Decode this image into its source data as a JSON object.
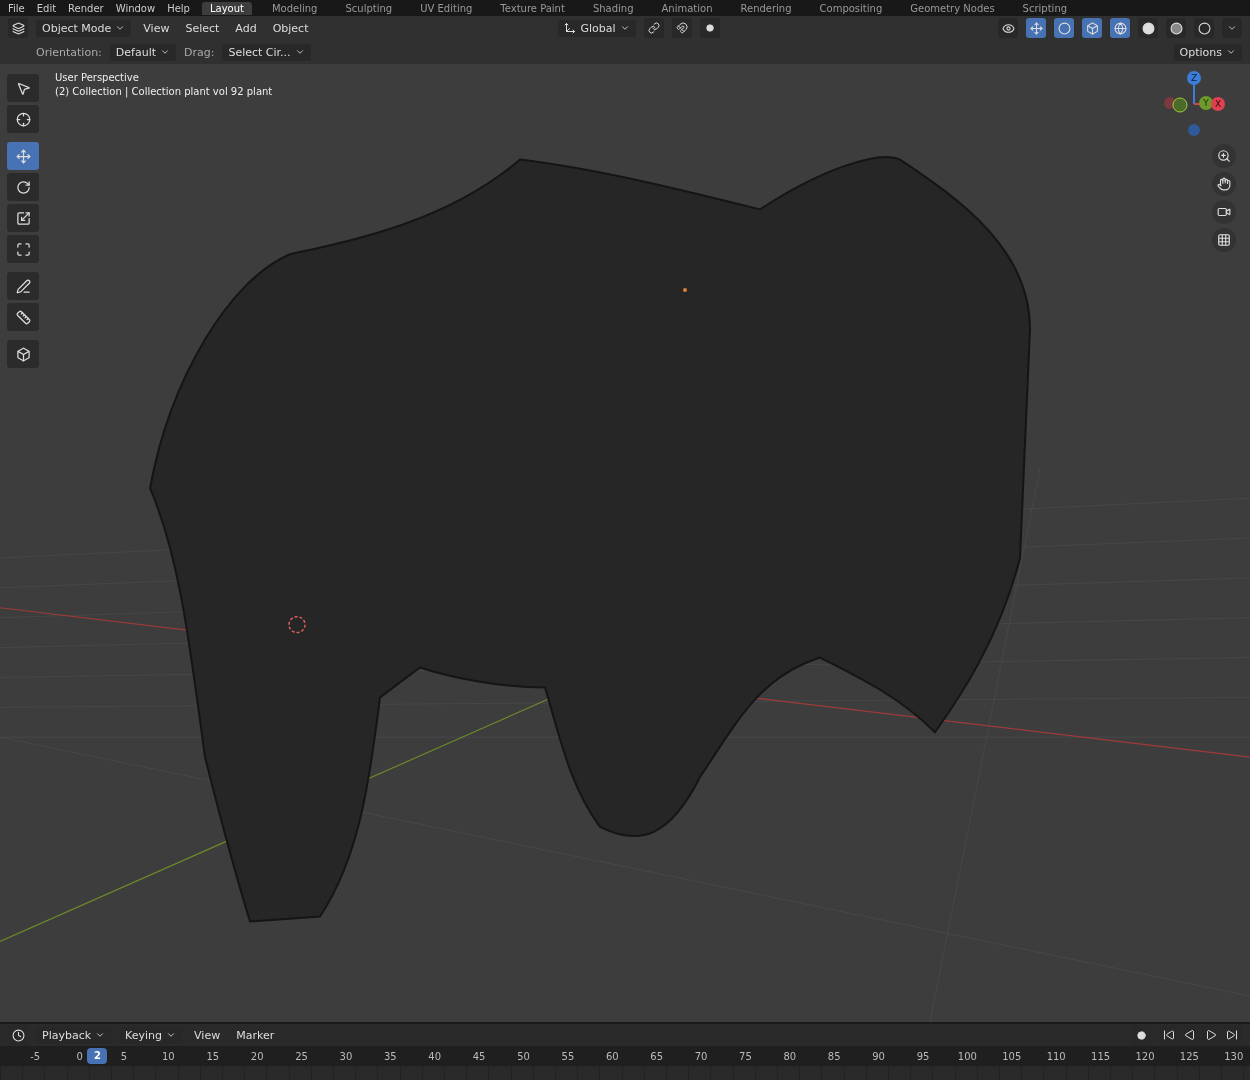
{
  "menu": [
    "File",
    "Edit",
    "Render",
    "Window",
    "Help"
  ],
  "workspaces": [
    {
      "label": "Layout",
      "selected": true
    },
    {
      "label": "Modeling",
      "selected": false
    },
    {
      "label": "Sculpting",
      "selected": false
    },
    {
      "label": "UV Editing",
      "selected": false
    },
    {
      "label": "Texture Paint",
      "selected": false
    },
    {
      "label": "Shading",
      "selected": false
    },
    {
      "label": "Animation",
      "selected": false
    },
    {
      "label": "Rendering",
      "selected": false
    },
    {
      "label": "Compositing",
      "selected": false
    },
    {
      "label": "Geometry Nodes",
      "selected": false
    },
    {
      "label": "Scripting",
      "selected": false
    }
  ],
  "header": {
    "mode": "Object Mode",
    "menus": [
      "View",
      "Select",
      "Add",
      "Object"
    ],
    "transform_orientation": "Global",
    "options": "Options"
  },
  "tool_settings": {
    "orientation_label": "Orientation:",
    "orientation": "Default",
    "drag_label": "Drag:",
    "drag": "Select Cir..."
  },
  "viewport": {
    "title": "User Perspective",
    "subtitle": "(2) Collection | Collection plant vol 92 plant",
    "gizmo_axes": [
      "Z",
      "Y",
      "X"
    ]
  },
  "toolbar": [
    {
      "kind": "select",
      "selected": false
    },
    {
      "kind": "cursor",
      "selected": false
    },
    {
      "kind": "move",
      "selected": true
    },
    {
      "kind": "rotate",
      "selected": false
    },
    {
      "kind": "scale",
      "selected": false
    },
    {
      "kind": "transform",
      "selected": false
    },
    {
      "kind": "annotate",
      "selected": false
    },
    {
      "kind": "measure",
      "selected": false
    },
    {
      "kind": "add-cube",
      "selected": false
    }
  ],
  "shading": [
    {
      "kind": "wireframe",
      "selected": true
    },
    {
      "kind": "solid",
      "selected": false
    },
    {
      "kind": "material",
      "selected": false
    },
    {
      "kind": "rendered",
      "selected": false
    }
  ],
  "timeline": {
    "menus": [
      {
        "label": "Playback",
        "dropdown": true
      },
      {
        "label": "Keying",
        "dropdown": true
      },
      {
        "label": "View",
        "dropdown": false
      },
      {
        "label": "Marker",
        "dropdown": false
      }
    ],
    "frames": [
      "-5",
      "0",
      "5",
      "10",
      "15",
      "20",
      "25",
      "30",
      "35",
      "40",
      "45",
      "50",
      "55",
      "60",
      "65",
      "70",
      "75",
      "80",
      "85",
      "90",
      "95",
      "100",
      "105",
      "110",
      "115",
      "120",
      "125",
      "130"
    ],
    "current_frame": "2"
  }
}
